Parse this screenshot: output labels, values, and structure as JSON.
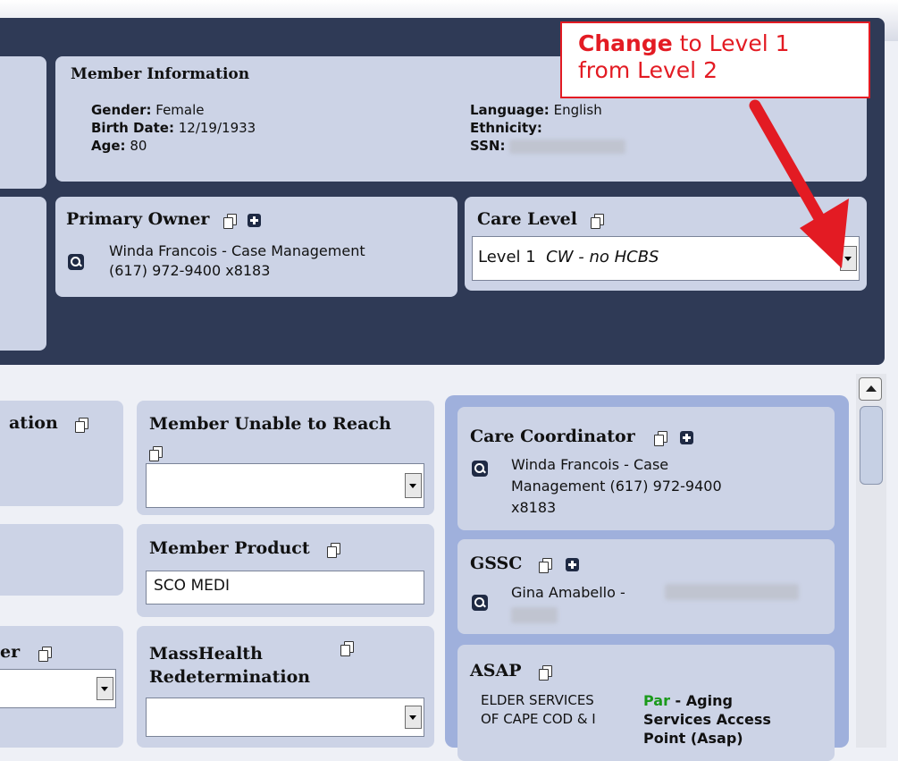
{
  "member_info": {
    "title": "Member Information",
    "gender_label": "Gender:",
    "gender": "Female",
    "birth_label": "Birth Date:",
    "birth": "12/19/1933",
    "age_label": "Age:",
    "age": "80",
    "language_label": "Language:",
    "language": "English",
    "ethnicity_label": "Ethnicity:",
    "ssn_label": "SSN:"
  },
  "primary_owner": {
    "title": "Primary Owner",
    "line1": "Winda Francois - Case Management",
    "line2": "(617) 972-9400 x8183"
  },
  "care_level": {
    "title": "Care Level",
    "level": "Level 1",
    "desc": "CW - no HCBS"
  },
  "annotation": {
    "change": "Change",
    "rest1": " to Level 1",
    "line2": "from Level 2"
  },
  "left_cards": {
    "card1_title": "ation",
    "card3_title": "er"
  },
  "unable_to_reach": {
    "title": "Member Unable to Reach"
  },
  "member_product": {
    "title": "Member Product",
    "value": "SCO MEDI"
  },
  "masshealth": {
    "title_line1": "MassHealth",
    "title_line2": "Redetermination"
  },
  "care_coordinator": {
    "title": "Care Coordinator",
    "line1": "Winda Francois - Case",
    "line2": "Management (617) 972-9400",
    "line3": "x8183"
  },
  "gssc": {
    "title": "GSSC",
    "name": "Gina Amabello -"
  },
  "asap": {
    "title": "ASAP",
    "org_line1": "ELDER SERVICES",
    "org_line2": "OF CAPE COD & I",
    "par": "Par",
    "desc1": " - Aging",
    "desc2": "Services Access",
    "desc3": "Point (Asap)"
  },
  "colors": {
    "header_bg": "#2f3a56",
    "card_bg": "#ccd3e6",
    "annotation": "#e31b23",
    "par": "#1b9a1b"
  },
  "icons": [
    "copy-icon",
    "plus-icon",
    "magnifier-icon",
    "chevron-down-icon",
    "scroll-up-icon",
    "arrow-icon"
  ]
}
